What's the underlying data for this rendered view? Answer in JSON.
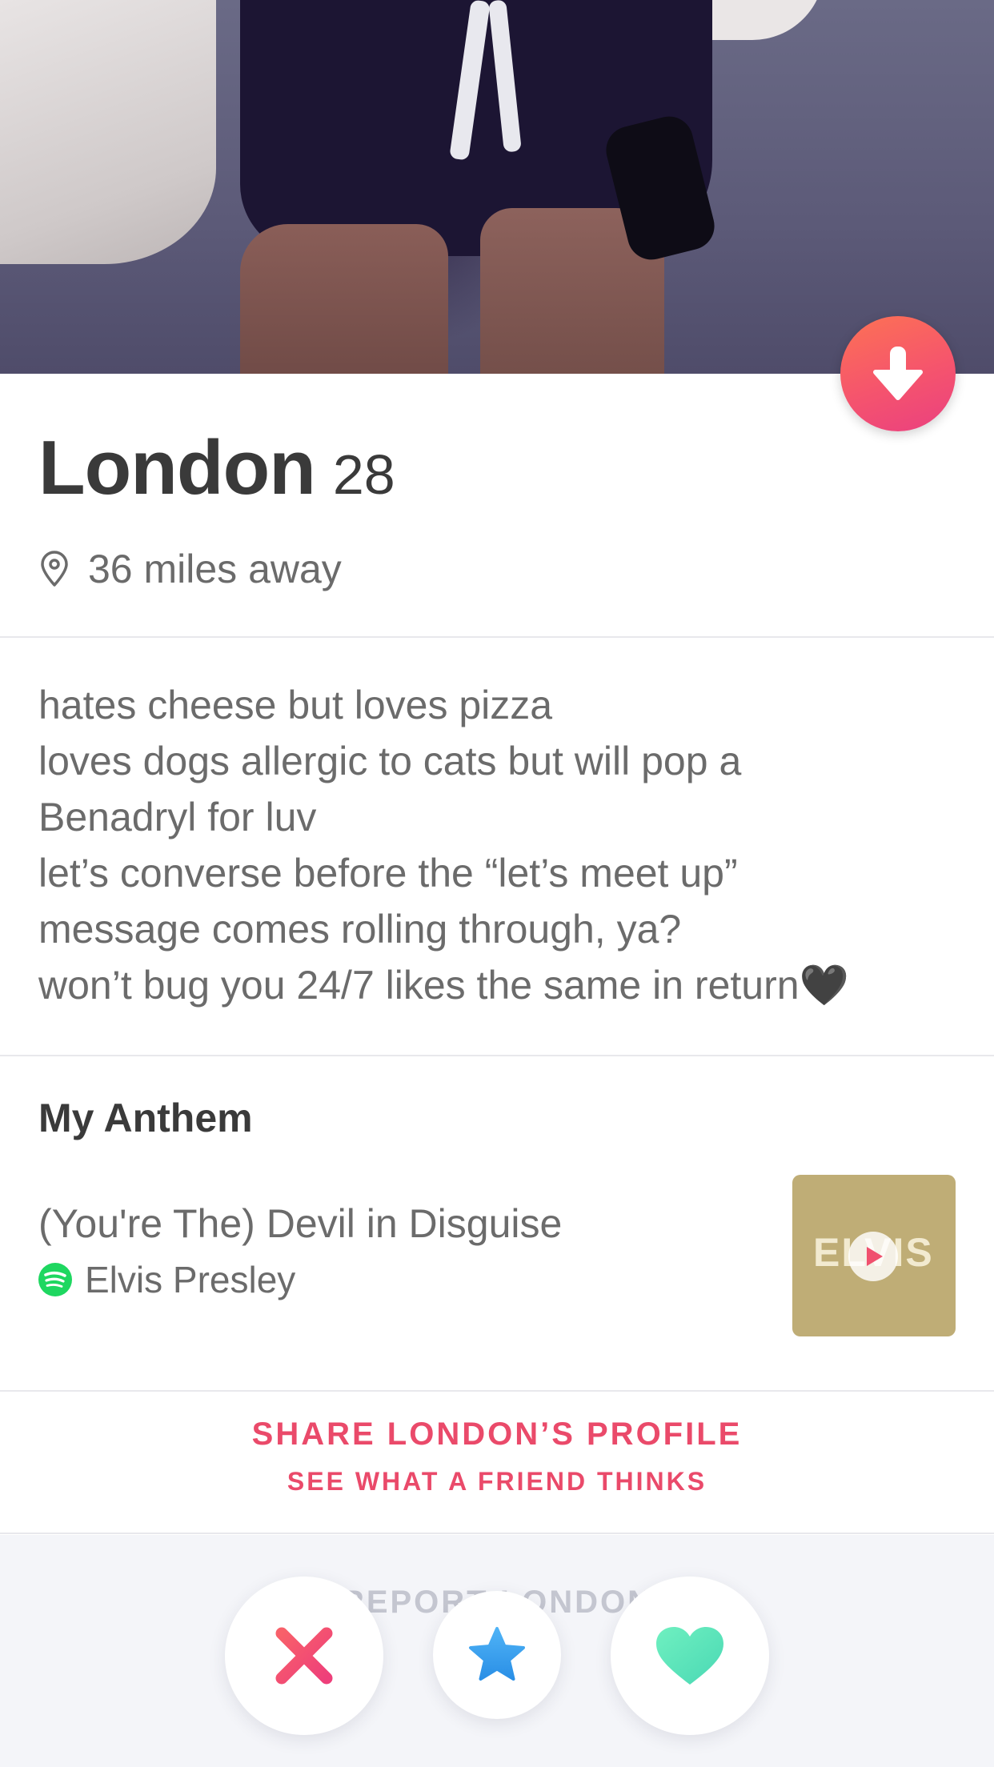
{
  "profile": {
    "name": "London",
    "age": "28",
    "distance": "36 miles away"
  },
  "bio": {
    "lines": [
      "hates cheese but loves pizza",
      "loves dogs allergic to cats but will pop a",
      "Benadryl for luv",
      "let’s converse before the “let’s meet up”",
      "message comes rolling through, ya?",
      "won’t bug you 24/7 likes the same in return🖤"
    ]
  },
  "anthem": {
    "heading": "My Anthem",
    "song": "(You're The) Devil in Disguise",
    "artist": "Elvis Presley",
    "album_art_text": "ELVIS"
  },
  "share": {
    "title": "SHARE LONDON’S PROFILE",
    "subtitle": "SEE WHAT A FRIEND THINKS"
  },
  "report": {
    "label": "REPORT LONDON"
  },
  "actions": {
    "nope_icon": "x-icon",
    "super_like_icon": "star-icon",
    "like_icon": "heart-icon"
  },
  "colors": {
    "accent": "#ea4a6a",
    "nope": "#f0506e",
    "super_like": "#3aa0f0",
    "like": "#5fe0b0",
    "spotify": "#1ed760"
  }
}
